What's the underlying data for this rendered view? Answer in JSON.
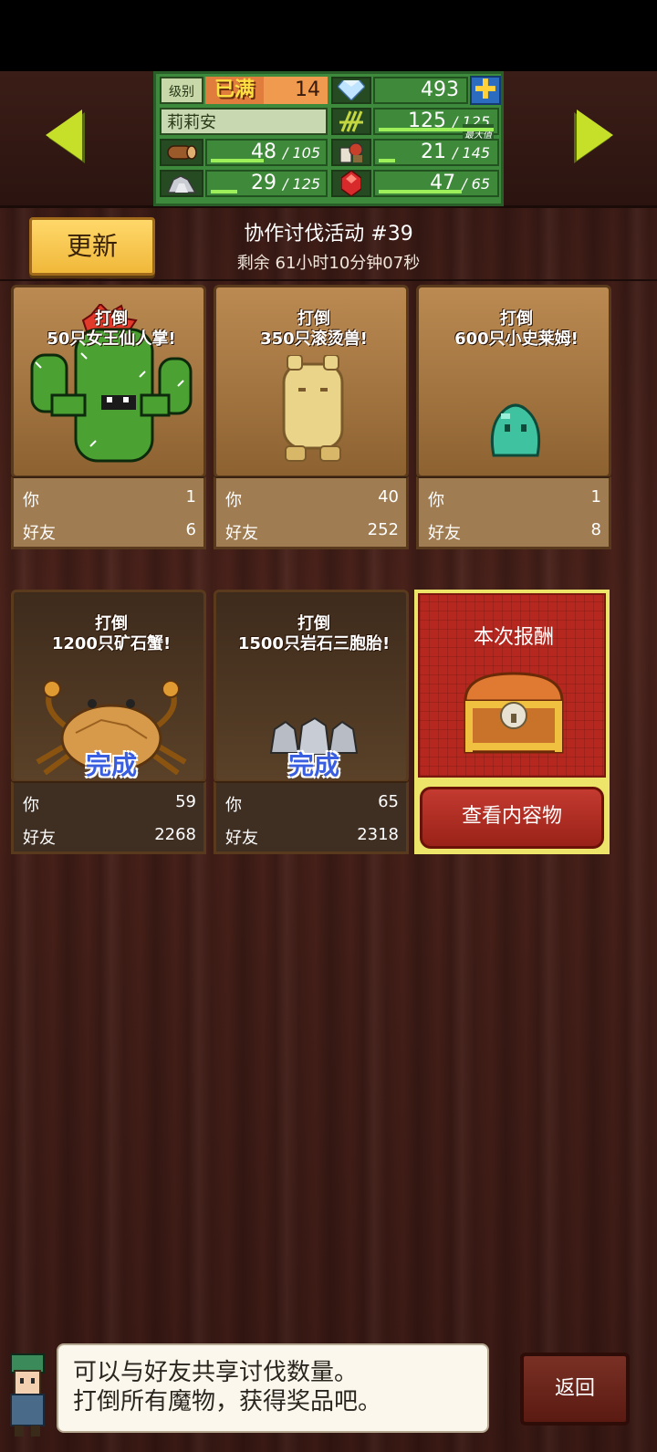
{
  "header": {
    "level_label": "级别",
    "level_status": "已满",
    "level": "14",
    "gems": "493",
    "player_name": "莉莉安",
    "grass": {
      "value": "125",
      "max": "/ 125",
      "max_tag": "最大值"
    },
    "wood": {
      "value": "48",
      "max": "/ 105"
    },
    "ingredients": {
      "value": "21",
      "max": "/ 145"
    },
    "ore": {
      "value": "29",
      "max": "/ 125"
    },
    "crystal": {
      "value": "47",
      "max": "/ 65"
    }
  },
  "refresh_label": "更新",
  "event": {
    "title": "协作讨伐活动 #39",
    "time_left": "剩余 61小时10分钟07秒"
  },
  "stat_labels": {
    "you": "你",
    "friends": "好友"
  },
  "done_label": "完成",
  "cards": [
    {
      "line1": "打倒",
      "line2": "50只女王仙人掌!",
      "you": "1",
      "friends": "6",
      "done": false
    },
    {
      "line1": "打倒",
      "line2": "350只滚烫兽!",
      "you": "40",
      "friends": "252",
      "done": false
    },
    {
      "line1": "打倒",
      "line2": "600只小史莱姆!",
      "you": "1",
      "friends": "8",
      "done": false
    },
    {
      "line1": "打倒",
      "line2": "1200只矿石蟹!",
      "you": "59",
      "friends": "2268",
      "done": true
    },
    {
      "line1": "打倒",
      "line2": "1500只岩石三胞胎!",
      "you": "65",
      "friends": "2318",
      "done": true
    }
  ],
  "reward": {
    "title": "本次报酬",
    "view_label": "查看内容物"
  },
  "dialog": {
    "line1": "可以与好友共享讨伐数量。",
    "line2": "打倒所有魔物，获得奖品吧。"
  },
  "back_label": "返回",
  "colors": {
    "accent_green": "#3f8a3a",
    "reward_red": "#b6281f",
    "done_blue": "#3a5ee0"
  },
  "bars": {
    "grass": 1.0,
    "wood": 0.46,
    "ingredients": 0.14,
    "ore": 0.23,
    "crystal": 0.72
  }
}
